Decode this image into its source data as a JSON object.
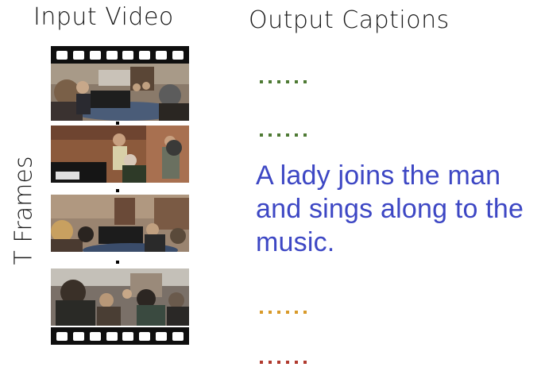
{
  "input_title": "Input Video",
  "output_title": "Output Captions",
  "frames_label": "T Frames",
  "caption": "A lady joins the man and sings along to the music.",
  "caption_color": "#3d47c4",
  "dot_rows": [
    {
      "color": "#4e7a34"
    },
    {
      "color": "#4e7a34"
    },
    {
      "color": "#d89a2a"
    },
    {
      "color": "#b03a2e"
    }
  ],
  "frames": [
    {
      "id": 1,
      "description_icon": "video-frame-icon"
    },
    {
      "id": 2,
      "description_icon": "video-frame-icon"
    },
    {
      "id": 3,
      "description_icon": "video-frame-icon"
    },
    {
      "id": 4,
      "description_icon": "video-frame-icon"
    }
  ]
}
